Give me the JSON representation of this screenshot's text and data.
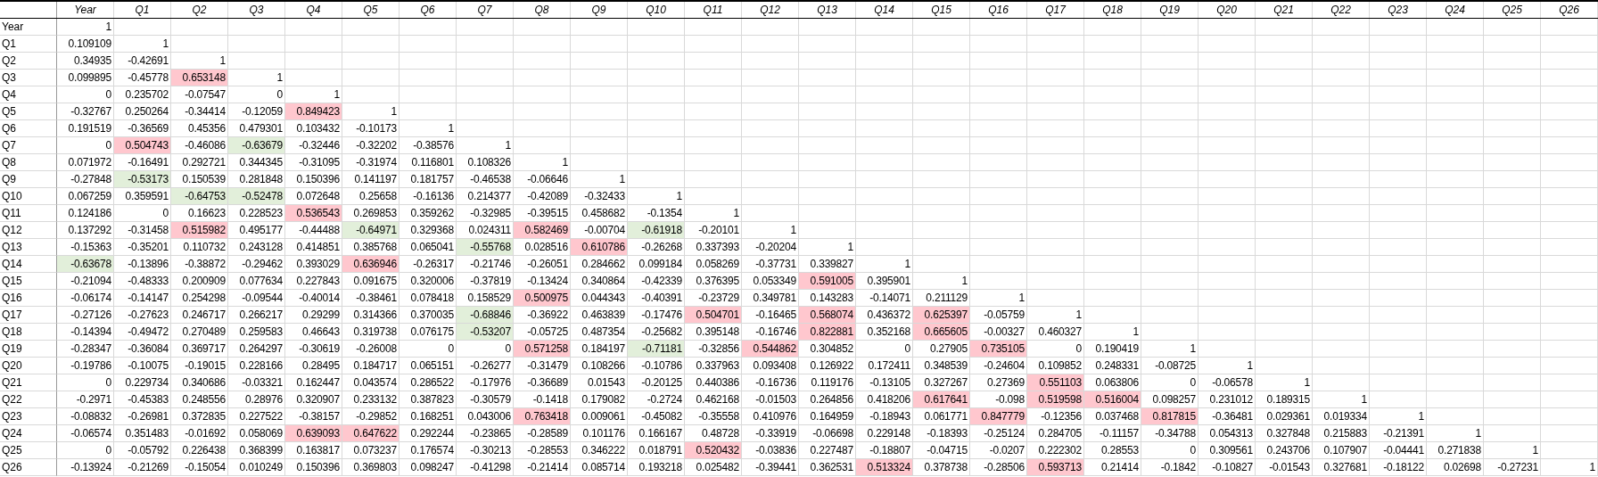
{
  "table": {
    "columns": [
      "Year",
      "Q1",
      "Q2",
      "Q3",
      "Q4",
      "Q5",
      "Q6",
      "Q7",
      "Q8",
      "Q9",
      "Q10",
      "Q11",
      "Q12",
      "Q13",
      "Q14",
      "Q15",
      "Q16",
      "Q17",
      "Q18",
      "Q19",
      "Q20",
      "Q21",
      "Q22",
      "Q23",
      "Q24",
      "Q25",
      "Q26"
    ],
    "rows": [
      {
        "label": "Year",
        "cells": [
          {
            "value": "1"
          }
        ]
      },
      {
        "label": "Q1",
        "cells": [
          {
            "value": "0.109109"
          },
          {
            "value": "1"
          }
        ]
      },
      {
        "label": "Q2",
        "cells": [
          {
            "value": "0.34935"
          },
          {
            "value": "-0.42691"
          },
          {
            "value": "1"
          }
        ]
      },
      {
        "label": "Q3",
        "cells": [
          {
            "value": "0.099895"
          },
          {
            "value": "-0.45778"
          },
          {
            "value": "0.653148",
            "color": "#ffc7ce"
          },
          {
            "value": "1"
          }
        ]
      },
      {
        "label": "Q4",
        "cells": [
          {
            "value": "0"
          },
          {
            "value": "0.235702"
          },
          {
            "value": "-0.07547"
          },
          {
            "value": "0"
          },
          {
            "value": "1"
          }
        ]
      },
      {
        "label": "Q5",
        "cells": [
          {
            "value": "-0.32767"
          },
          {
            "value": "0.250264"
          },
          {
            "value": "-0.34414"
          },
          {
            "value": "-0.12059"
          },
          {
            "value": "0.849423",
            "color": "#ffc7ce"
          },
          {
            "value": "1"
          }
        ]
      },
      {
        "label": "Q6",
        "cells": [
          {
            "value": "0.191519"
          },
          {
            "value": "-0.36569"
          },
          {
            "value": "0.45356"
          },
          {
            "value": "0.479301"
          },
          {
            "value": "0.103432"
          },
          {
            "value": "-0.10173"
          },
          {
            "value": "1"
          }
        ]
      },
      {
        "label": "Q7",
        "cells": [
          {
            "value": "0"
          },
          {
            "value": "0.504743",
            "color": "#ffc7ce"
          },
          {
            "value": "-0.46086"
          },
          {
            "value": "-0.63679",
            "color": "#e2efda"
          },
          {
            "value": "-0.32446"
          },
          {
            "value": "-0.32202"
          },
          {
            "value": "-0.38576"
          },
          {
            "value": "1"
          }
        ]
      },
      {
        "label": "Q8",
        "cells": [
          {
            "value": "0.071972"
          },
          {
            "value": "-0.16491"
          },
          {
            "value": "0.292721"
          },
          {
            "value": "0.344345"
          },
          {
            "value": "-0.31095"
          },
          {
            "value": "-0.31974"
          },
          {
            "value": "0.116801"
          },
          {
            "value": "0.108326"
          },
          {
            "value": "1"
          }
        ]
      },
      {
        "label": "Q9",
        "cells": [
          {
            "value": "-0.27848"
          },
          {
            "value": "-0.53173",
            "color": "#e2efda"
          },
          {
            "value": "0.150539"
          },
          {
            "value": "0.281848"
          },
          {
            "value": "0.150396"
          },
          {
            "value": "0.141197"
          },
          {
            "value": "0.181757"
          },
          {
            "value": "-0.46538"
          },
          {
            "value": "-0.06646"
          },
          {
            "value": "1"
          }
        ]
      },
      {
        "label": "Q10",
        "cells": [
          {
            "value": "0.067259"
          },
          {
            "value": "0.359591"
          },
          {
            "value": "-0.64753",
            "color": "#e2efda"
          },
          {
            "value": "-0.52478",
            "color": "#e2efda"
          },
          {
            "value": "0.072648"
          },
          {
            "value": "0.25658"
          },
          {
            "value": "-0.16136"
          },
          {
            "value": "0.214377"
          },
          {
            "value": "-0.42089"
          },
          {
            "value": "-0.32433"
          },
          {
            "value": "1"
          }
        ]
      },
      {
        "label": "Q11",
        "cells": [
          {
            "value": "0.124186"
          },
          {
            "value": "0"
          },
          {
            "value": "0.16623"
          },
          {
            "value": "0.228523"
          },
          {
            "value": "0.536543",
            "color": "#ffc7ce"
          },
          {
            "value": "0.269853"
          },
          {
            "value": "0.359262"
          },
          {
            "value": "-0.32985"
          },
          {
            "value": "-0.39515"
          },
          {
            "value": "0.458682"
          },
          {
            "value": "-0.1354"
          },
          {
            "value": "1"
          }
        ]
      },
      {
        "label": "Q12",
        "cells": [
          {
            "value": "0.137292"
          },
          {
            "value": "-0.31458"
          },
          {
            "value": "0.515982",
            "color": "#ffc7ce"
          },
          {
            "value": "0.495177"
          },
          {
            "value": "-0.44488"
          },
          {
            "value": "-0.64971",
            "color": "#e2efda"
          },
          {
            "value": "0.329368"
          },
          {
            "value": "0.024311"
          },
          {
            "value": "0.582469",
            "color": "#ffc7ce"
          },
          {
            "value": "-0.00704"
          },
          {
            "value": "-0.61918",
            "color": "#e2efda"
          },
          {
            "value": "-0.20101"
          },
          {
            "value": "1"
          }
        ]
      },
      {
        "label": "Q13",
        "cells": [
          {
            "value": "-0.15363"
          },
          {
            "value": "-0.35201"
          },
          {
            "value": "0.110732"
          },
          {
            "value": "0.243128"
          },
          {
            "value": "0.414851"
          },
          {
            "value": "0.385768"
          },
          {
            "value": "0.065041"
          },
          {
            "value": "-0.55768",
            "color": "#e2efda"
          },
          {
            "value": "0.028516"
          },
          {
            "value": "0.610786",
            "color": "#ffc7ce"
          },
          {
            "value": "-0.26268"
          },
          {
            "value": "0.337393"
          },
          {
            "value": "-0.20204"
          },
          {
            "value": "1"
          }
        ]
      },
      {
        "label": "Q14",
        "cells": [
          {
            "value": "-0.63678",
            "color": "#e2efda"
          },
          {
            "value": "-0.13896"
          },
          {
            "value": "-0.38872"
          },
          {
            "value": "-0.29462"
          },
          {
            "value": "0.393029"
          },
          {
            "value": "0.636946",
            "color": "#ffc7ce"
          },
          {
            "value": "-0.26317"
          },
          {
            "value": "-0.21746"
          },
          {
            "value": "-0.26051"
          },
          {
            "value": "0.284662"
          },
          {
            "value": "0.099184"
          },
          {
            "value": "0.058269"
          },
          {
            "value": "-0.37731"
          },
          {
            "value": "0.339827"
          },
          {
            "value": "1"
          }
        ]
      },
      {
        "label": "Q15",
        "cells": [
          {
            "value": "-0.21094"
          },
          {
            "value": "-0.48333"
          },
          {
            "value": "0.200909"
          },
          {
            "value": "0.077634"
          },
          {
            "value": "0.227843"
          },
          {
            "value": "0.091675"
          },
          {
            "value": "0.320006"
          },
          {
            "value": "-0.37819"
          },
          {
            "value": "-0.13424"
          },
          {
            "value": "0.340864"
          },
          {
            "value": "-0.42339"
          },
          {
            "value": "0.376395"
          },
          {
            "value": "0.053349"
          },
          {
            "value": "0.591005",
            "color": "#ffc7ce"
          },
          {
            "value": "0.395901"
          },
          {
            "value": "1"
          }
        ]
      },
      {
        "label": "Q16",
        "cells": [
          {
            "value": "-0.06174"
          },
          {
            "value": "-0.14147"
          },
          {
            "value": "0.254298"
          },
          {
            "value": "-0.09544"
          },
          {
            "value": "-0.40014"
          },
          {
            "value": "-0.38461"
          },
          {
            "value": "0.078418"
          },
          {
            "value": "0.158529"
          },
          {
            "value": "0.500975",
            "color": "#ffc7ce"
          },
          {
            "value": "0.044343"
          },
          {
            "value": "-0.40391"
          },
          {
            "value": "-0.23729"
          },
          {
            "value": "0.349781"
          },
          {
            "value": "0.143283"
          },
          {
            "value": "-0.14071"
          },
          {
            "value": "0.211129"
          },
          {
            "value": "1"
          }
        ]
      },
      {
        "label": "Q17",
        "cells": [
          {
            "value": "-0.27126"
          },
          {
            "value": "-0.27623"
          },
          {
            "value": "0.246717"
          },
          {
            "value": "0.266217"
          },
          {
            "value": "0.29299"
          },
          {
            "value": "0.314366"
          },
          {
            "value": "0.370035"
          },
          {
            "value": "-0.68846",
            "color": "#e2efda"
          },
          {
            "value": "-0.36922"
          },
          {
            "value": "0.463839"
          },
          {
            "value": "-0.17476"
          },
          {
            "value": "0.504701",
            "color": "#ffc7ce"
          },
          {
            "value": "-0.16465"
          },
          {
            "value": "0.568074",
            "color": "#ffc7ce"
          },
          {
            "value": "0.436372"
          },
          {
            "value": "0.625397",
            "color": "#ffc7ce"
          },
          {
            "value": "-0.05759"
          },
          {
            "value": "1"
          }
        ]
      },
      {
        "label": "Q18",
        "cells": [
          {
            "value": "-0.14394"
          },
          {
            "value": "-0.49472"
          },
          {
            "value": "0.270489"
          },
          {
            "value": "0.259583"
          },
          {
            "value": "0.46643"
          },
          {
            "value": "0.319738"
          },
          {
            "value": "0.076175"
          },
          {
            "value": "-0.53207",
            "color": "#e2efda"
          },
          {
            "value": "-0.05725"
          },
          {
            "value": "0.487354"
          },
          {
            "value": "-0.25682"
          },
          {
            "value": "0.395148"
          },
          {
            "value": "-0.16746"
          },
          {
            "value": "0.822881",
            "color": "#ffc7ce"
          },
          {
            "value": "0.352168"
          },
          {
            "value": "0.665605",
            "color": "#ffc7ce"
          },
          {
            "value": "-0.00327"
          },
          {
            "value": "0.460327"
          },
          {
            "value": "1"
          }
        ]
      },
      {
        "label": "Q19",
        "cells": [
          {
            "value": "-0.28347"
          },
          {
            "value": "-0.36084"
          },
          {
            "value": "0.369717"
          },
          {
            "value": "0.264297"
          },
          {
            "value": "-0.30619"
          },
          {
            "value": "-0.26008"
          },
          {
            "value": "0"
          },
          {
            "value": "0"
          },
          {
            "value": "0.571258",
            "color": "#ffc7ce"
          },
          {
            "value": "0.184197"
          },
          {
            "value": "-0.71181",
            "color": "#e2efda"
          },
          {
            "value": "-0.32856"
          },
          {
            "value": "0.544862",
            "color": "#ffc7ce"
          },
          {
            "value": "0.304852"
          },
          {
            "value": "0"
          },
          {
            "value": "0.27905"
          },
          {
            "value": "0.735105",
            "color": "#ffc7ce"
          },
          {
            "value": "0"
          },
          {
            "value": "0.190419"
          },
          {
            "value": "1"
          }
        ]
      },
      {
        "label": "Q20",
        "cells": [
          {
            "value": "-0.19786"
          },
          {
            "value": "-0.10075"
          },
          {
            "value": "-0.19015"
          },
          {
            "value": "0.228166"
          },
          {
            "value": "0.28495"
          },
          {
            "value": "0.184717"
          },
          {
            "value": "0.065151"
          },
          {
            "value": "-0.26277"
          },
          {
            "value": "-0.31479"
          },
          {
            "value": "0.108266"
          },
          {
            "value": "-0.10786"
          },
          {
            "value": "0.337963"
          },
          {
            "value": "0.093408"
          },
          {
            "value": "0.126922"
          },
          {
            "value": "0.172411"
          },
          {
            "value": "0.348539"
          },
          {
            "value": "-0.24604"
          },
          {
            "value": "0.109852"
          },
          {
            "value": "0.248331"
          },
          {
            "value": "-0.08725"
          },
          {
            "value": "1"
          }
        ]
      },
      {
        "label": "Q21",
        "cells": [
          {
            "value": "0"
          },
          {
            "value": "0.229734"
          },
          {
            "value": "0.340686"
          },
          {
            "value": "-0.03321"
          },
          {
            "value": "0.162447"
          },
          {
            "value": "0.043574"
          },
          {
            "value": "0.286522"
          },
          {
            "value": "-0.17976"
          },
          {
            "value": "-0.36689"
          },
          {
            "value": "0.01543"
          },
          {
            "value": "-0.20125"
          },
          {
            "value": "0.440386"
          },
          {
            "value": "-0.16736"
          },
          {
            "value": "0.119176"
          },
          {
            "value": "-0.13105"
          },
          {
            "value": "0.327267"
          },
          {
            "value": "0.27369"
          },
          {
            "value": "0.551103",
            "color": "#ffc7ce"
          },
          {
            "value": "0.063806"
          },
          {
            "value": "0"
          },
          {
            "value": "-0.06578"
          },
          {
            "value": "1"
          }
        ]
      },
      {
        "label": "Q22",
        "cells": [
          {
            "value": "-0.2971"
          },
          {
            "value": "-0.45383"
          },
          {
            "value": "0.248556"
          },
          {
            "value": "0.28976"
          },
          {
            "value": "0.320907"
          },
          {
            "value": "0.233132"
          },
          {
            "value": "0.387823"
          },
          {
            "value": "-0.30579"
          },
          {
            "value": "-0.1418"
          },
          {
            "value": "0.179082"
          },
          {
            "value": "-0.2724"
          },
          {
            "value": "0.462168"
          },
          {
            "value": "-0.01503"
          },
          {
            "value": "0.264856"
          },
          {
            "value": "0.418206"
          },
          {
            "value": "0.617641",
            "color": "#ffc7ce"
          },
          {
            "value": "-0.098"
          },
          {
            "value": "0.519598",
            "color": "#ffc7ce"
          },
          {
            "value": "0.516004",
            "color": "#ffc7ce"
          },
          {
            "value": "0.098257"
          },
          {
            "value": "0.231012"
          },
          {
            "value": "0.189315"
          },
          {
            "value": "1"
          }
        ]
      },
      {
        "label": "Q23",
        "cells": [
          {
            "value": "-0.08832"
          },
          {
            "value": "-0.26981"
          },
          {
            "value": "0.372835"
          },
          {
            "value": "0.227522"
          },
          {
            "value": "-0.38157"
          },
          {
            "value": "-0.29852"
          },
          {
            "value": "0.168251"
          },
          {
            "value": "0.043006"
          },
          {
            "value": "0.763418",
            "color": "#ffc7ce"
          },
          {
            "value": "0.009061"
          },
          {
            "value": "-0.45082"
          },
          {
            "value": "-0.35558"
          },
          {
            "value": "0.410976"
          },
          {
            "value": "0.164959"
          },
          {
            "value": "-0.18943"
          },
          {
            "value": "0.061771"
          },
          {
            "value": "0.847779",
            "color": "#ffc7ce"
          },
          {
            "value": "-0.12356"
          },
          {
            "value": "0.037468"
          },
          {
            "value": "0.817815",
            "color": "#ffc7ce"
          },
          {
            "value": "-0.36481"
          },
          {
            "value": "0.029361"
          },
          {
            "value": "0.019334"
          },
          {
            "value": "1"
          }
        ]
      },
      {
        "label": "Q24",
        "cells": [
          {
            "value": "-0.06574"
          },
          {
            "value": "0.351483"
          },
          {
            "value": "-0.01692"
          },
          {
            "value": "0.058069"
          },
          {
            "value": "0.639093",
            "color": "#ffc7ce"
          },
          {
            "value": "0.647622",
            "color": "#ffc7ce"
          },
          {
            "value": "0.292244"
          },
          {
            "value": "-0.23865"
          },
          {
            "value": "-0.28589"
          },
          {
            "value": "0.101176"
          },
          {
            "value": "0.166167"
          },
          {
            "value": "0.48728"
          },
          {
            "value": "-0.33919"
          },
          {
            "value": "-0.06698"
          },
          {
            "value": "0.229148"
          },
          {
            "value": "-0.18393"
          },
          {
            "value": "-0.25124"
          },
          {
            "value": "0.284705"
          },
          {
            "value": "-0.11157"
          },
          {
            "value": "-0.34788"
          },
          {
            "value": "0.054313"
          },
          {
            "value": "0.327848"
          },
          {
            "value": "0.215883"
          },
          {
            "value": "-0.21391"
          },
          {
            "value": "1"
          }
        ]
      },
      {
        "label": "Q25",
        "cells": [
          {
            "value": "0"
          },
          {
            "value": "-0.05792"
          },
          {
            "value": "0.226438"
          },
          {
            "value": "0.368399"
          },
          {
            "value": "0.163817"
          },
          {
            "value": "0.073237"
          },
          {
            "value": "0.176574"
          },
          {
            "value": "-0.30213"
          },
          {
            "value": "-0.28553"
          },
          {
            "value": "0.346222"
          },
          {
            "value": "0.018791"
          },
          {
            "value": "0.520432",
            "color": "#ffc7ce"
          },
          {
            "value": "-0.03836"
          },
          {
            "value": "0.227487"
          },
          {
            "value": "-0.18807"
          },
          {
            "value": "-0.04715"
          },
          {
            "value": "-0.0207"
          },
          {
            "value": "0.222302"
          },
          {
            "value": "0.28553"
          },
          {
            "value": "0"
          },
          {
            "value": "0.309561"
          },
          {
            "value": "0.243706"
          },
          {
            "value": "0.107907"
          },
          {
            "value": "-0.04441"
          },
          {
            "value": "0.271838"
          },
          {
            "value": "1"
          }
        ]
      },
      {
        "label": "Q26",
        "cells": [
          {
            "value": "-0.13924"
          },
          {
            "value": "-0.21269"
          },
          {
            "value": "-0.15054"
          },
          {
            "value": "0.010249"
          },
          {
            "value": "0.150396"
          },
          {
            "value": "0.369803"
          },
          {
            "value": "0.098247"
          },
          {
            "value": "-0.41298"
          },
          {
            "value": "-0.21414"
          },
          {
            "value": "0.085714"
          },
          {
            "value": "0.193218"
          },
          {
            "value": "0.025482"
          },
          {
            "value": "-0.39441"
          },
          {
            "value": "0.362531"
          },
          {
            "value": "0.513324",
            "color": "#ffc7ce"
          },
          {
            "value": "0.378738"
          },
          {
            "value": "-0.28506"
          },
          {
            "value": "0.593713",
            "color": "#ffc7ce"
          },
          {
            "value": "0.21414"
          },
          {
            "value": "-0.1842"
          },
          {
            "value": "-0.10827"
          },
          {
            "value": "-0.01543"
          },
          {
            "value": "0.327681"
          },
          {
            "value": "-0.18122"
          },
          {
            "value": "0.02698"
          },
          {
            "value": "-0.27231"
          },
          {
            "value": "1"
          }
        ]
      }
    ]
  }
}
